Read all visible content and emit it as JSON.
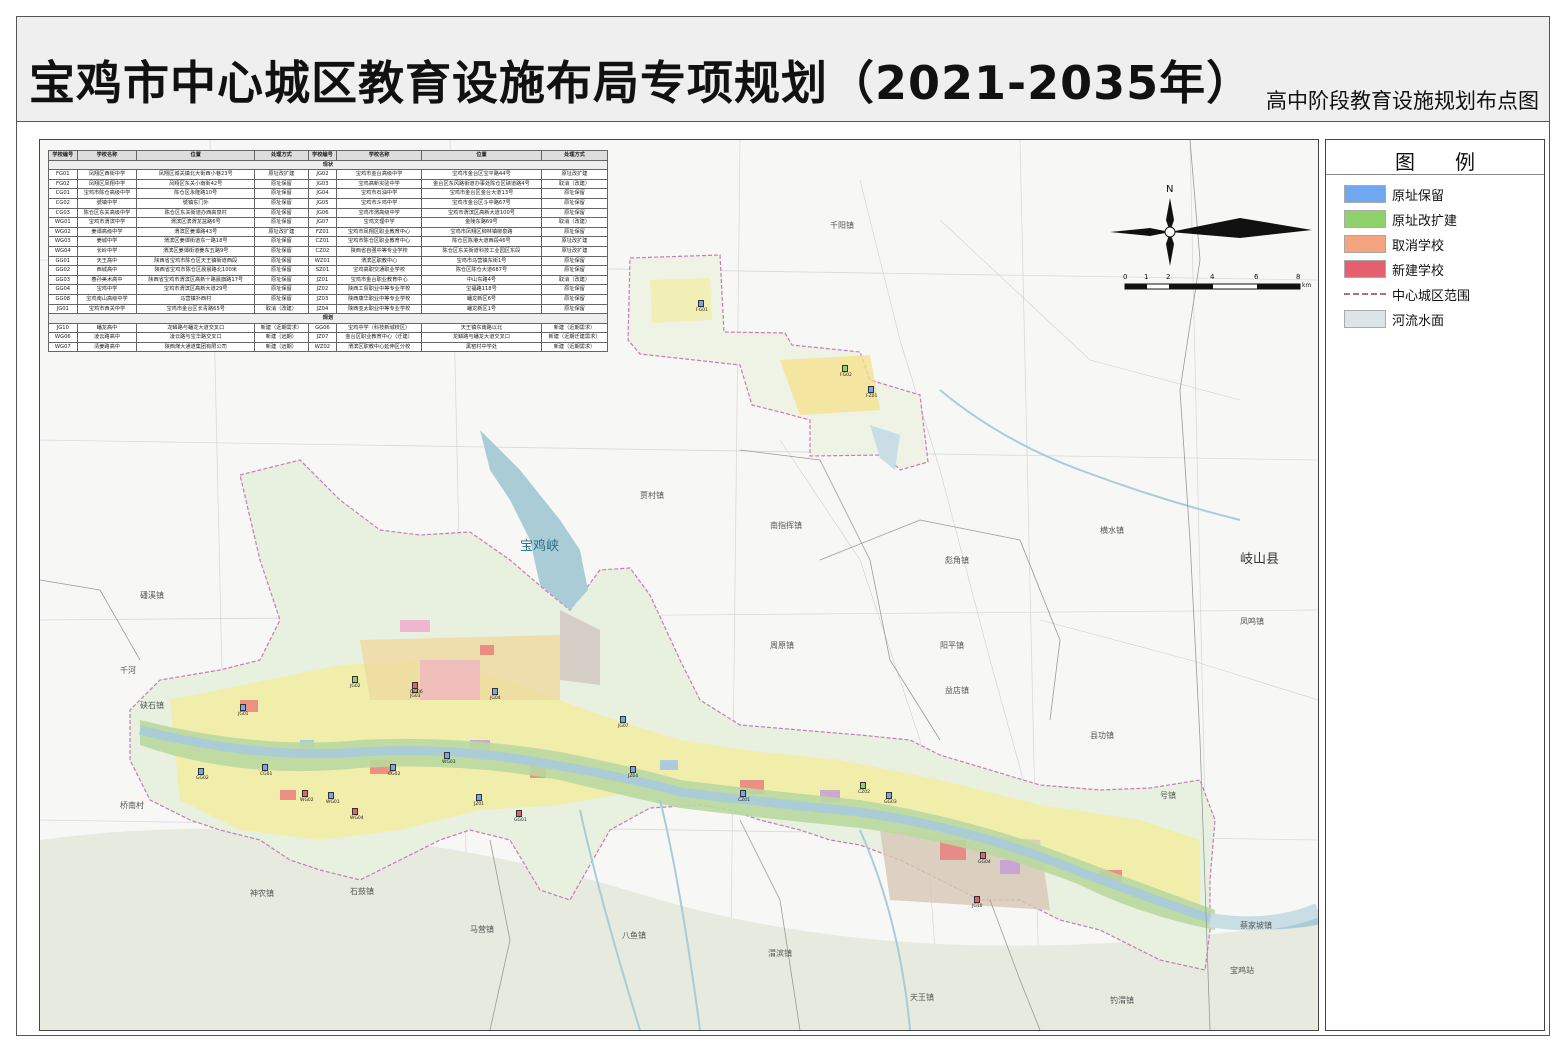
{
  "header": {
    "title": "宝鸡市中心城区教育设施布局专项规划（2021-2035年）",
    "subtitle": "高中阶段教育设施规划布点图"
  },
  "legend": {
    "title": "图例",
    "items": [
      {
        "label": "原址保留",
        "color": "#6fa8ef",
        "kind": "box"
      },
      {
        "label": "原址改扩建",
        "color": "#8fd16a",
        "kind": "box"
      },
      {
        "label": "取消学校",
        "color": "#f4a57f",
        "kind": "box"
      },
      {
        "label": "新建学校",
        "color": "#e5606f",
        "kind": "box"
      },
      {
        "label": "中心城区范围",
        "color": "#b07070",
        "kind": "dash"
      },
      {
        "label": "河流水面",
        "color": "#dbe5e8",
        "kind": "box"
      }
    ]
  },
  "compass": {
    "north": "N"
  },
  "scalebar": {
    "ticks": [
      "0",
      "1",
      "2",
      "4",
      "6",
      "8"
    ],
    "unit": "km"
  },
  "table": {
    "headers": [
      "学校编号",
      "学校名称",
      "位置",
      "处理方式",
      "学校编号",
      "学校名称",
      "位置",
      "处理方式"
    ],
    "section_existing": "现状",
    "section_planned": "规划",
    "existing_rows": [
      [
        "FG01",
        "凤翔区西街中学",
        "凤翔区城关镇北大街西小巷23号",
        "原址改扩建",
        "JG02",
        "宝鸡市金台高级中学",
        "宝鸡市金台区宝平路44号",
        "原址改扩建"
      ],
      [
        "FG02",
        "凤翔区凤翔中学",
        "凤翔区东关小南街42号",
        "原址保留",
        "JG03",
        "宝鸡高新实验中学",
        "金台区东风路街道办事处陈仓区硖道路4号",
        "取消（改建）"
      ],
      [
        "CG01",
        "宝鸡市陈仓高级中学",
        "陈仓区永隆路10号",
        "原址保留",
        "JG04",
        "宝鸡市石油中学",
        "宝鸡市金台区金台大道13号",
        "原址保留"
      ],
      [
        "CG02",
        "號镇中学",
        "號镇东门外",
        "原址保留",
        "JG05",
        "宝鸡市斗鸡中学",
        "宝鸡市金台区斗中路67号",
        "原址保留"
      ],
      [
        "CG03",
        "陈仓区东关高级中学",
        "陈仓区东关街道办西高泉村",
        "原址保留",
        "JG06",
        "宝鸡市渭高级中学",
        "宝鸡市渭滨区高新大道100号",
        "原址保留"
      ],
      [
        "WG01",
        "宝鸡市渭滨中学",
        "渭滨区滨渭龙盆路6号",
        "原址保留",
        "JG07",
        "宝鸡文理中学",
        "金陵东路69号",
        "取消（改建）"
      ],
      [
        "WG02",
        "姜谭高级中学",
        "渭滨区姜谭路43号",
        "原址改扩建",
        "FZ01",
        "宝鸡市凤翔区职业教育中心",
        "宝鸡市凤翔区柳林镇柳泉路",
        "原址保留"
      ],
      [
        "WG03",
        "姜城中学",
        "渭滨区姜谭街道东一路18号",
        "原址保留",
        "CZ01",
        "宝鸡市陈仓区职业教育中心",
        "陈仓区陈港大道西段46号",
        "原址改扩建"
      ],
      [
        "WG04",
        "长岭中学",
        "渭滨区姜谭街道姜东五路9号",
        "原址保留",
        "CZ02",
        "陕西省自强中等专业学校",
        "陈仓区东关街道科技工业园区东段",
        "原址改扩建"
      ],
      [
        "GG01",
        "天王高中",
        "陕西省宝鸡市陈仓区天王镇街道西段",
        "原址保留",
        "WZ01",
        "渭滨区职教中心",
        "宝鸡市马营镇东街1号",
        "原址保留"
      ],
      [
        "GG02",
        "西城高中",
        "陕西省宝鸡市陈仓区晨晨路北100米",
        "原址保留",
        "SZ01",
        "宝鸡高职交通职业学校",
        "陈仓区陈仓大道687号",
        "原址保留"
      ],
      [
        "GG03",
        "春孙美术高中",
        "陕西省宝鸡市渭滨区高新十路晨旗路17号",
        "原址保留",
        "JZ01",
        "宝鸡市金台职业教育中心",
        "中山东路4号",
        "取消（改建）"
      ],
      [
        "GG04",
        "宝鸡中学",
        "宝鸡市渭滨区高新大道29号",
        "原址保留",
        "JZ02",
        "陕西工贸职业中等专业学校",
        "宝福路118号",
        "原址保留"
      ],
      [
        "GG08",
        "宝鸡南山高级中学",
        "马营镇扑西村",
        "原址保留",
        "JZ03",
        "陕西康华职业中等专业学校",
        "蟠龙新区6号",
        "原址保留"
      ],
      [
        "JG01",
        "宝鸡市西关中学",
        "宝鸡市金台区长青路65号",
        "取消（改建）",
        "JZ04",
        "陕西亚太职业中等专业学校",
        "蟠龙新区1号",
        "原址保留"
      ]
    ],
    "planned_rows": [
      [
        "JG10",
        "蟠龙高中",
        "龙鳞路与蟠龙大道交叉口",
        "新建（近期需求）",
        "GG06",
        "宝鸡中学（科技新城校区）",
        "天王镇东南路以北",
        "新建（近期需求）"
      ],
      [
        "WG06",
        "凌云路高中",
        "凌云路与宝华路交叉口",
        "新建（远期）",
        "JZ07",
        "金台区职业教育中心（迁建）",
        "龙鳞路与蟠龙大道交叉口",
        "新建（近期迁建需求）"
      ],
      [
        "WG07",
        "清姜路高中",
        "陕西煤大通道集团有限公司",
        "新建（远期）",
        "WZ02",
        "渭滨区职教中心延伸区分校",
        "黑窑村中学处",
        "新建（近期需求）"
      ]
    ]
  },
  "place_labels": {
    "kind": "map place names",
    "names": [
      "岐山县",
      "凤鸣镇",
      "蔡家坡镇",
      "八鱼镇",
      "渭滨镇",
      "桥南村",
      "石鼓镇",
      "马营镇",
      "神农镇",
      "天王镇",
      "号镇",
      "钓渭镇",
      "千河",
      "磻溪镇",
      "硖石镇",
      "贾村镇",
      "千阳镇",
      "县功镇",
      "彪角镇",
      "南指挥镇",
      "周原镇",
      "阳平镇",
      "益店镇",
      "横水镇",
      "宝鸡峡",
      "宝鸡站"
    ]
  },
  "schools": [
    {
      "code": "FG01",
      "status": "keep"
    },
    {
      "code": "FG02",
      "status": "expand"
    },
    {
      "code": "FZ01",
      "status": "keep"
    },
    {
      "code": "JG02",
      "status": "expand"
    },
    {
      "code": "JG03",
      "status": "cancel"
    },
    {
      "code": "JG04",
      "status": "keep"
    },
    {
      "code": "JG07",
      "status": "keep"
    },
    {
      "code": "JG01",
      "status": "keep"
    },
    {
      "code": "GG02",
      "status": "keep"
    },
    {
      "code": "CG01",
      "status": "keep"
    },
    {
      "code": "CG02",
      "status": "keep"
    },
    {
      "code": "WG01",
      "status": "keep"
    },
    {
      "code": "WG02",
      "status": "new"
    },
    {
      "code": "WG04",
      "status": "new"
    },
    {
      "code": "WG03",
      "status": "keep"
    },
    {
      "code": "JZ01",
      "status": "keep"
    },
    {
      "code": "JZ04",
      "status": "keep"
    },
    {
      "code": "GG01",
      "status": "new"
    },
    {
      "code": "CZ01",
      "status": "keep"
    },
    {
      "code": "CZ02",
      "status": "expand"
    },
    {
      "code": "GG03",
      "status": "keep"
    },
    {
      "code": "GG04",
      "status": "new"
    },
    {
      "code": "JG10",
      "status": "new"
    },
    {
      "code": "GG06",
      "status": "new"
    }
  ],
  "colors": {
    "keep": "#6fa8ef",
    "expand": "#8fd16a",
    "cancel": "#f4a57f",
    "new": "#e5606f",
    "water": "#c8dde4"
  }
}
